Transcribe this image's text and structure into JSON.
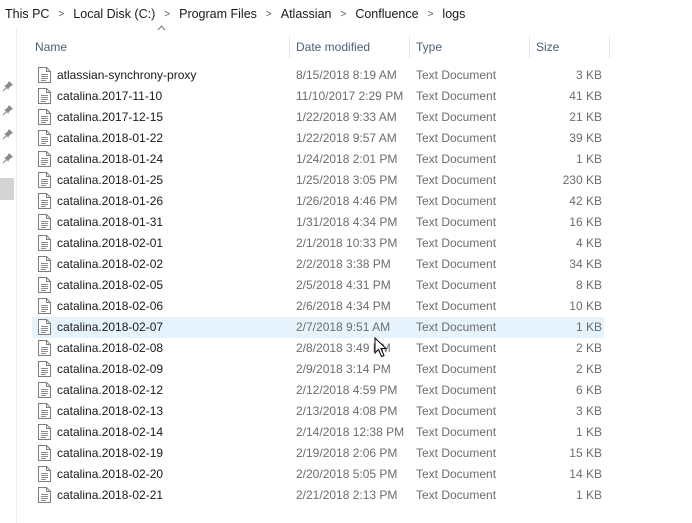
{
  "breadcrumb": [
    "This PC",
    "Local Disk (C:)",
    "Program Files",
    "Atlassian",
    "Confluence",
    "logs"
  ],
  "columns": {
    "name": "Name",
    "date": "Date modified",
    "type": "Type",
    "size": "Size"
  },
  "files": [
    {
      "name": "atlassian-synchrony-proxy",
      "date": "8/15/2018 8:19 AM",
      "type": "Text Document",
      "size": "3 KB"
    },
    {
      "name": "catalina.2017-11-10",
      "date": "11/10/2017 2:29 PM",
      "type": "Text Document",
      "size": "41 KB"
    },
    {
      "name": "catalina.2017-12-15",
      "date": "1/22/2018 9:33 AM",
      "type": "Text Document",
      "size": "21 KB"
    },
    {
      "name": "catalina.2018-01-22",
      "date": "1/22/2018 9:57 AM",
      "type": "Text Document",
      "size": "39 KB"
    },
    {
      "name": "catalina.2018-01-24",
      "date": "1/24/2018 2:01 PM",
      "type": "Text Document",
      "size": "1 KB"
    },
    {
      "name": "catalina.2018-01-25",
      "date": "1/25/2018 3:05 PM",
      "type": "Text Document",
      "size": "230 KB"
    },
    {
      "name": "catalina.2018-01-26",
      "date": "1/26/2018 4:46 PM",
      "type": "Text Document",
      "size": "42 KB"
    },
    {
      "name": "catalina.2018-01-31",
      "date": "1/31/2018 4:34 PM",
      "type": "Text Document",
      "size": "16 KB"
    },
    {
      "name": "catalina.2018-02-01",
      "date": "2/1/2018 10:33 PM",
      "type": "Text Document",
      "size": "4 KB"
    },
    {
      "name": "catalina.2018-02-02",
      "date": "2/2/2018 3:38 PM",
      "type": "Text Document",
      "size": "34 KB"
    },
    {
      "name": "catalina.2018-02-05",
      "date": "2/5/2018 4:31 PM",
      "type": "Text Document",
      "size": "8 KB"
    },
    {
      "name": "catalina.2018-02-06",
      "date": "2/6/2018 4:34 PM",
      "type": "Text Document",
      "size": "10 KB"
    },
    {
      "name": "catalina.2018-02-07",
      "date": "2/7/2018 9:51 AM",
      "type": "Text Document",
      "size": "1 KB"
    },
    {
      "name": "catalina.2018-02-08",
      "date": "2/8/2018 3:49 PM",
      "type": "Text Document",
      "size": "2 KB"
    },
    {
      "name": "catalina.2018-02-09",
      "date": "2/9/2018 3:14 PM",
      "type": "Text Document",
      "size": "2 KB"
    },
    {
      "name": "catalina.2018-02-12",
      "date": "2/12/2018 4:59 PM",
      "type": "Text Document",
      "size": "6 KB"
    },
    {
      "name": "catalina.2018-02-13",
      "date": "2/13/2018 4:08 PM",
      "type": "Text Document",
      "size": "3 KB"
    },
    {
      "name": "catalina.2018-02-14",
      "date": "2/14/2018 12:38 PM",
      "type": "Text Document",
      "size": "1 KB"
    },
    {
      "name": "catalina.2018-02-19",
      "date": "2/19/2018 2:06 PM",
      "type": "Text Document",
      "size": "15 KB"
    },
    {
      "name": "catalina.2018-02-20",
      "date": "2/20/2018 5:05 PM",
      "type": "Text Document",
      "size": "14 KB"
    },
    {
      "name": "catalina.2018-02-21",
      "date": "2/21/2018 2:13 PM",
      "type": "Text Document",
      "size": "1 KB"
    }
  ],
  "hovered_row": 12,
  "colors": {
    "header_text": "#4c607a",
    "hover_bg": "#e5f3ff",
    "secondary_text": "#6d6d6d"
  },
  "icons": {
    "file": "text-document-icon",
    "pin": "pin-icon",
    "sort": "sort-up-icon",
    "breadcrumb_sep": "chevron-right-icon"
  }
}
